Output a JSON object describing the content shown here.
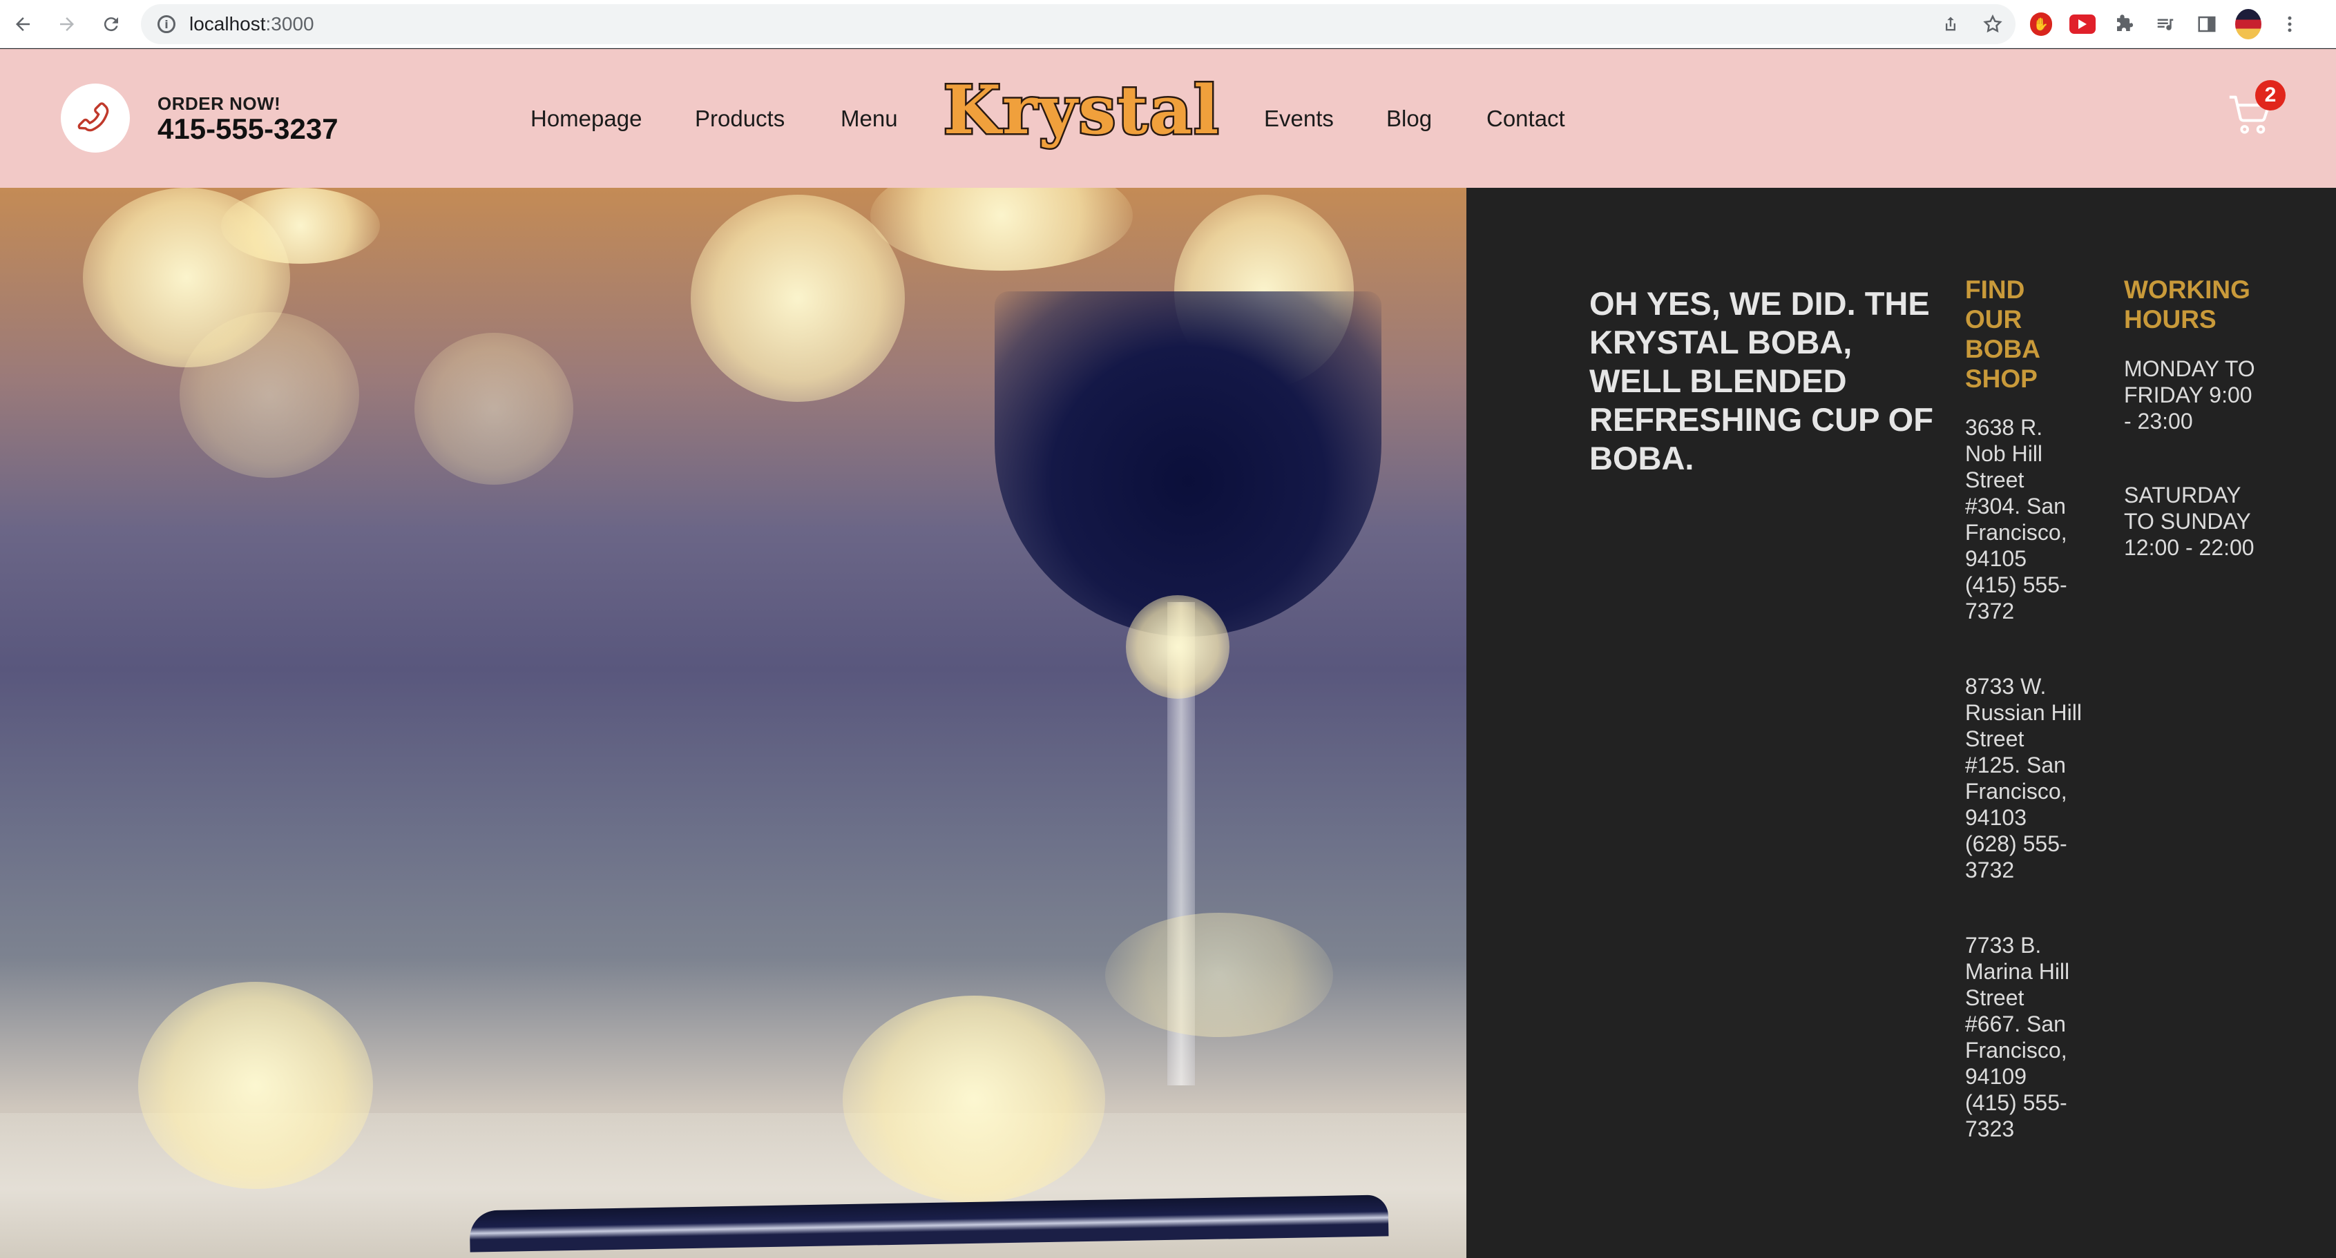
{
  "browser": {
    "url_host": "localhost",
    "url_port": ":3000"
  },
  "header": {
    "order_label": "ORDER NOW!",
    "order_phone": "415-555-3237",
    "nav": [
      "Homepage",
      "Products",
      "Menu",
      "Events",
      "Blog",
      "Contact"
    ],
    "logo_text": "Krystal",
    "cart_count": "2",
    "colors": {
      "background": "#f2c9c7",
      "logo_fill": "#f0a03c",
      "phone_icon": "#c0392b"
    }
  },
  "info": {
    "tagline": "OH YES, WE DID. THE KRYSTAL BOBA, WELL BLENDED REFRESHING CUP OF BOBA.",
    "shops_title": "FIND OUR BOBA SHOP",
    "shops": [
      "3638 R. Nob Hill Street #304. San Francisco, 94105 (415) 555-7372",
      "8733 W. Russian Hill Street #125. San Francisco, 94103 (628) 555-3732",
      "7733 B. Marina Hill Street #667. San Francisco, 94109 (415) 555-7323"
    ],
    "hours_title": "WORKING HOURS",
    "hours": [
      "MONDAY TO FRIDAY 9:00 - 23:00",
      "SATURDAY TO SUNDAY 12:00 - 22:00"
    ],
    "colors": {
      "panel": "#222222",
      "heading": "#c99a3a"
    }
  }
}
